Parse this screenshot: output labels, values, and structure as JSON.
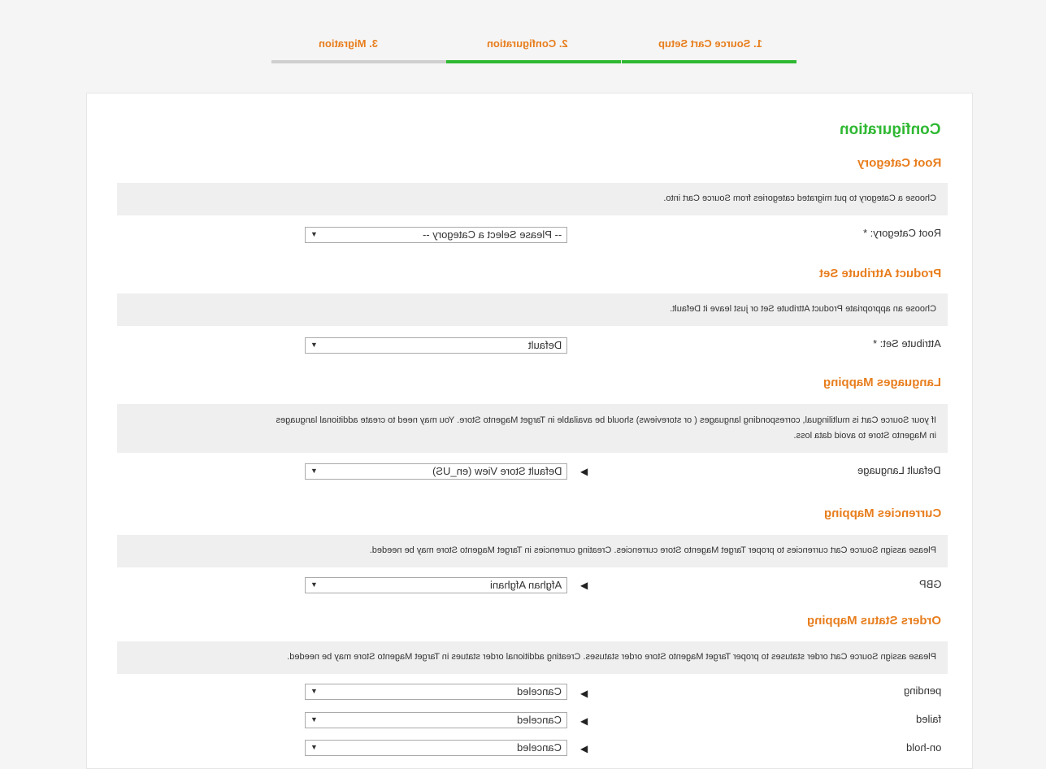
{
  "steps": [
    {
      "label": "1. Source Cart Setup"
    },
    {
      "label": "2. Configuration"
    },
    {
      "label": "3. Migration"
    }
  ],
  "colors": {
    "accent_green": "#2fb832",
    "accent_orange": "#e87e1e",
    "note_bg": "#efefef"
  },
  "page_title": "Configuration",
  "root_category": {
    "heading": "Root Category",
    "note": "Choose a Category to put migrated categories from Source Cart into.",
    "label": "Root Category: *",
    "value": "-- Please Select a Category --"
  },
  "attribute_set": {
    "heading": "Product Attribute Set",
    "note": "Choose an appropriate Product Attribute Set or just leave it Default.",
    "label": "Attribute Set: *",
    "value": "Default"
  },
  "languages": {
    "heading": "Languages Mapping",
    "note_line1": "If your Source Cart is multilingual, corresponding languages ( or storeviews) should be available in Target Magento Store. You may need to create additional languages",
    "note_line2": "in Magento Store to avoid data loss.",
    "label": "Default Language",
    "value": "Default Store View (en_US)"
  },
  "currencies": {
    "heading": "Currencies Mapping",
    "note": "Please assign Source Cart currencies to proper Target Magento Store currencies. Creating currencies in Target Magento Store may be needed.",
    "label": "GBP",
    "value": "Afghan Afghani"
  },
  "orders": {
    "heading": "Orders Status Mapping",
    "note": "Please assign Source Cart order statuses to proper Target Magento Store order statuses. Creating additional order statues in Target Magento Store may be needed.",
    "rows": [
      {
        "label": "pending",
        "value": "Canceled"
      },
      {
        "label": "failed",
        "value": "Canceled"
      },
      {
        "label": "on-hold",
        "value": "Canceled"
      }
    ]
  }
}
